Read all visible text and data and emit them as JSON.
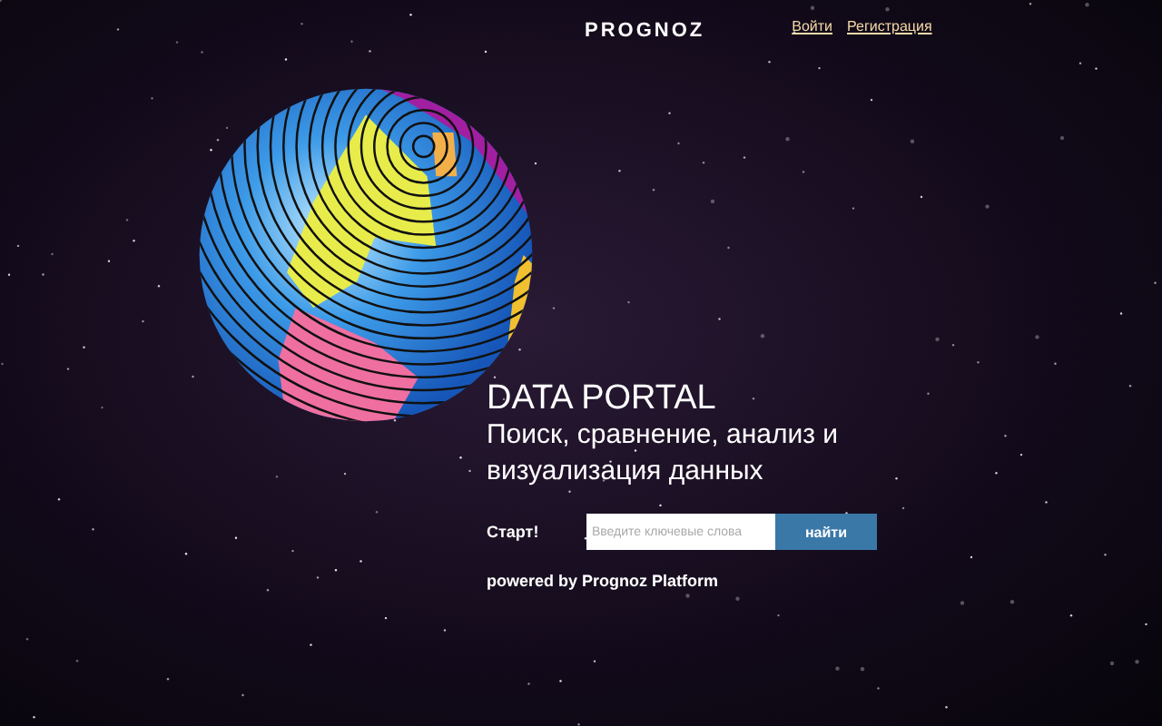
{
  "header": {
    "logo": "PROGNOZ",
    "links": [
      "Войти",
      "Регистрация"
    ]
  },
  "hero": {
    "title": "DATA PORTAL",
    "subtitle": "Поиск, сравнение, анализ и визуализация данных"
  },
  "search": {
    "label": "Старт!",
    "placeholder": "Введите ключевые слова",
    "button": "найти"
  },
  "footer": {
    "prefix": "powered by ",
    "brand": "Prognoz Platform"
  }
}
